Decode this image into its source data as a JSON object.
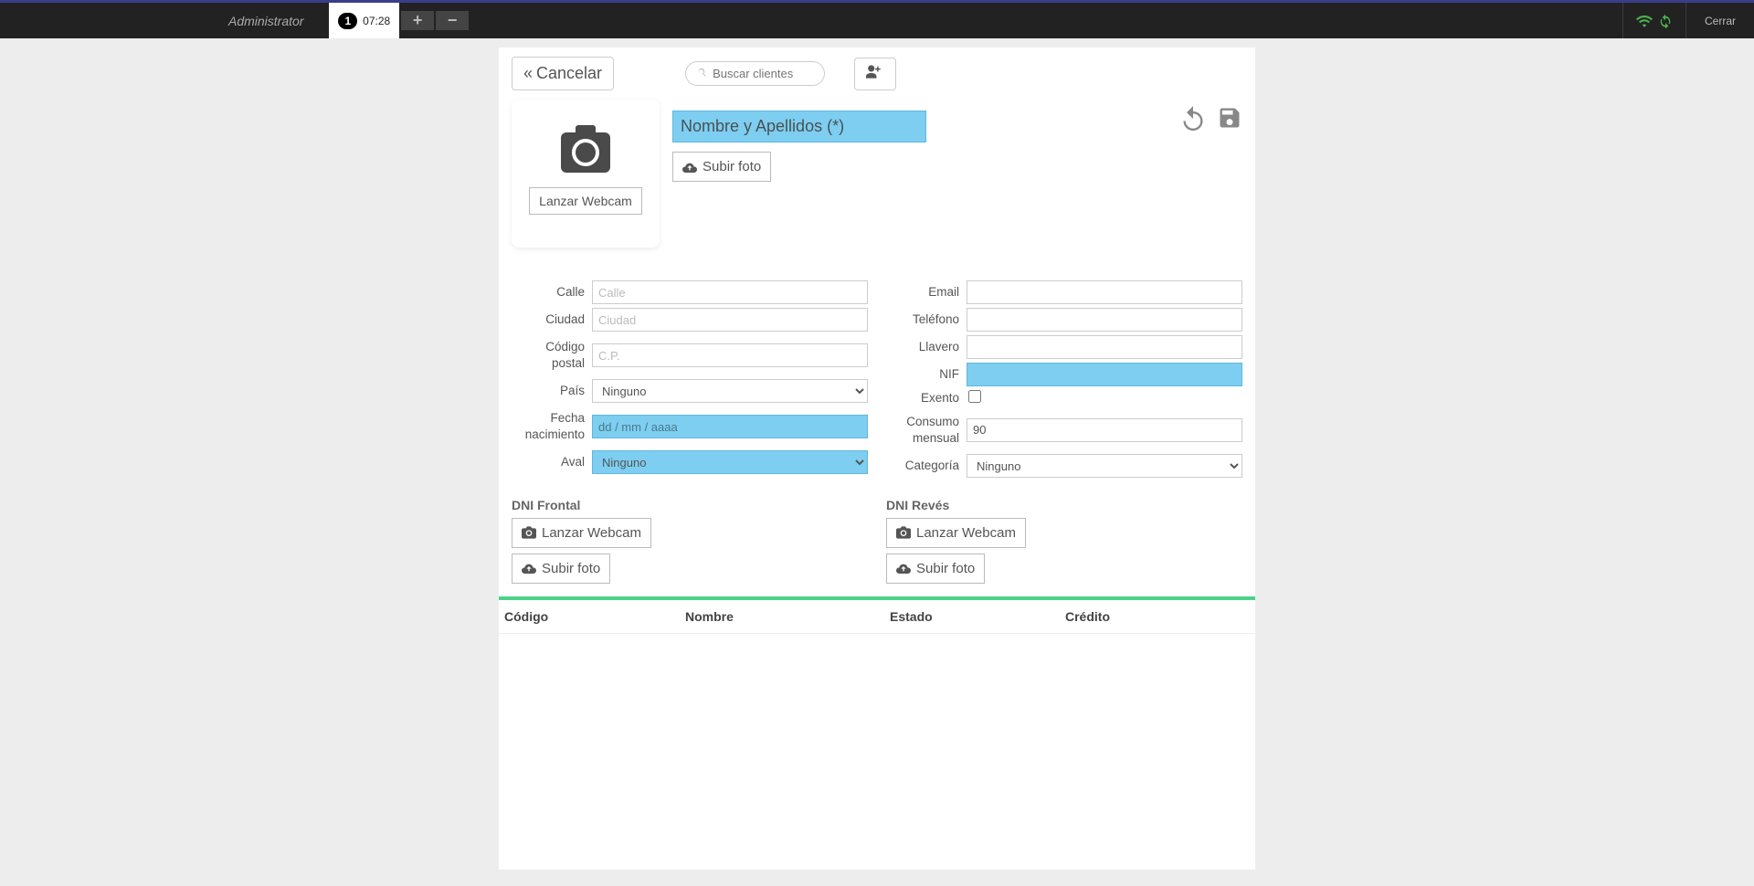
{
  "topbar": {
    "admin": "Administrator",
    "tab_badge": "1",
    "tab_time": "07:28",
    "close": "Cerrar"
  },
  "toolbar": {
    "cancel": "Cancelar",
    "search_placeholder": "Buscar clientes"
  },
  "photo": {
    "webcam": "Lanzar Webcam",
    "name_placeholder": "Nombre y Apellidos (*)",
    "upload": "Subir foto"
  },
  "fields": {
    "calle_label": "Calle",
    "calle_ph": "Calle",
    "ciudad_label": "Ciudad",
    "ciudad_ph": "Ciudad",
    "cp_label": "Código postal",
    "cp_ph": "C.P.",
    "pais_label": "País",
    "pais_opt": "Ninguno",
    "fnac_label": "Fecha nacimiento",
    "fnac_ph": "dd / mm / aaaa",
    "aval_label": "Aval",
    "aval_opt": "Ninguno",
    "email_label": "Email",
    "tel_label": "Teléfono",
    "llav_label": "Llavero",
    "nif_label": "NIF",
    "exento_label": "Exento",
    "consumo_label": "Consumo mensual",
    "consumo_val": "90",
    "cat_label": "Categoría",
    "cat_opt": "Ninguno"
  },
  "dni": {
    "front": "DNI Frontal",
    "back": "DNI Revés",
    "webcam": "Lanzar Webcam",
    "upload": "Subir foto"
  },
  "table": {
    "codigo": "Código",
    "nombre": "Nombre",
    "estado": "Estado",
    "credito": "Crédito"
  }
}
